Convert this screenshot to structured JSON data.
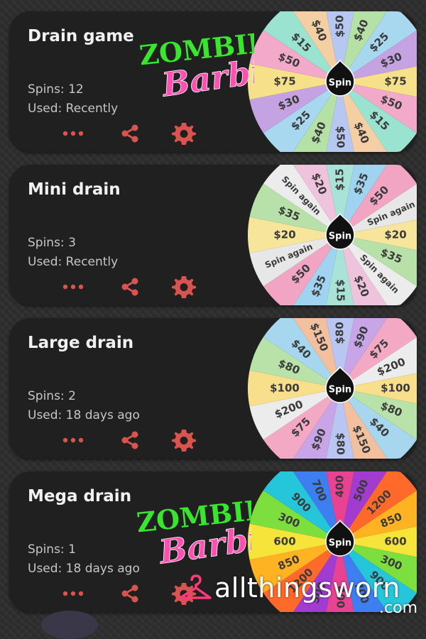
{
  "colors": {
    "accent_icon": "#d9534f",
    "card_bg": "#202020",
    "title_text": "#f1f1f1",
    "meta_text": "#c6c6c6",
    "wheel_hub": "#111111",
    "logo_green": "#39e52f",
    "logo_pink": "#ff4fb0"
  },
  "icons": {
    "more": "more-horizontal-icon",
    "share": "share-icon",
    "settings": "gear-icon",
    "spin": "spin-hub-icon",
    "hanger": "hanger-icon"
  },
  "cards": [
    {
      "title": "Drain game",
      "spins": "Spins: 12",
      "used": "Used: Recently",
      "wheel": {
        "hub_label": "Spin",
        "segments": [
          {
            "label": "$40",
            "color": "#b5e0a6"
          },
          {
            "label": "$25",
            "color": "#a7d8f0"
          },
          {
            "label": "$30",
            "color": "#c5a3e3"
          },
          {
            "label": "$75",
            "color": "#f7e08a"
          },
          {
            "label": "$50",
            "color": "#f3a9c9"
          },
          {
            "label": "$15",
            "color": "#9be3d1"
          },
          {
            "label": "$40",
            "color": "#f4cfa3"
          },
          {
            "label": "$50",
            "color": "#b6c7f2"
          }
        ]
      }
    },
    {
      "title": "Mini drain",
      "spins": "Spins: 3",
      "used": "Used: Recently",
      "wheel": {
        "hub_label": "Spin",
        "segments": [
          {
            "label": "$35",
            "color": "#9fd3ef"
          },
          {
            "label": "$50",
            "color": "#f2a5c2"
          },
          {
            "label": "Spin again",
            "color": "#e7e7e7"
          },
          {
            "label": "$20",
            "color": "#f6e59a"
          },
          {
            "label": "$35",
            "color": "#b7e1a8"
          },
          {
            "label": "Spin again",
            "color": "#ececec"
          },
          {
            "label": "$20",
            "color": "#f0c3dd"
          },
          {
            "label": "$15",
            "color": "#a9e3d8"
          }
        ]
      }
    },
    {
      "title": "Large drain",
      "spins": "Spins: 2",
      "used": "Used: 18 days ago",
      "wheel": {
        "hub_label": "Spin",
        "segments": [
          {
            "label": "$90",
            "color": "#c7a5e6"
          },
          {
            "label": "$75",
            "color": "#f3a8c4"
          },
          {
            "label": "$200",
            "color": "#ececec"
          },
          {
            "label": "$100",
            "color": "#f7df8c"
          },
          {
            "label": "$80",
            "color": "#b8e2a7"
          },
          {
            "label": "$40",
            "color": "#a7d7ef"
          },
          {
            "label": "$150",
            "color": "#f2c09e"
          },
          {
            "label": "$80",
            "color": "#b9c6f1"
          }
        ]
      }
    },
    {
      "title": "Mega drain",
      "spins": "Spins: 1",
      "used": "Used: 18 days ago",
      "wheel": {
        "hub_label": "Spin",
        "segments": [
          {
            "label": "500",
            "color": "#a23cd1"
          },
          {
            "label": "1200",
            "color": "#ff6a2a"
          },
          {
            "label": "850",
            "color": "#ffb322"
          },
          {
            "label": "600",
            "color": "#f7e43a"
          },
          {
            "label": "300",
            "color": "#7ddf3e"
          },
          {
            "label": "900",
            "color": "#26c6da"
          },
          {
            "label": "700",
            "color": "#3d7ff0"
          },
          {
            "label": "400",
            "color": "#e84393"
          }
        ]
      }
    }
  ],
  "logo": {
    "line1": "ZOMBIE",
    "line2": "Barbie"
  },
  "watermark": {
    "text": "allthingsworn",
    "suffix": ".com"
  }
}
